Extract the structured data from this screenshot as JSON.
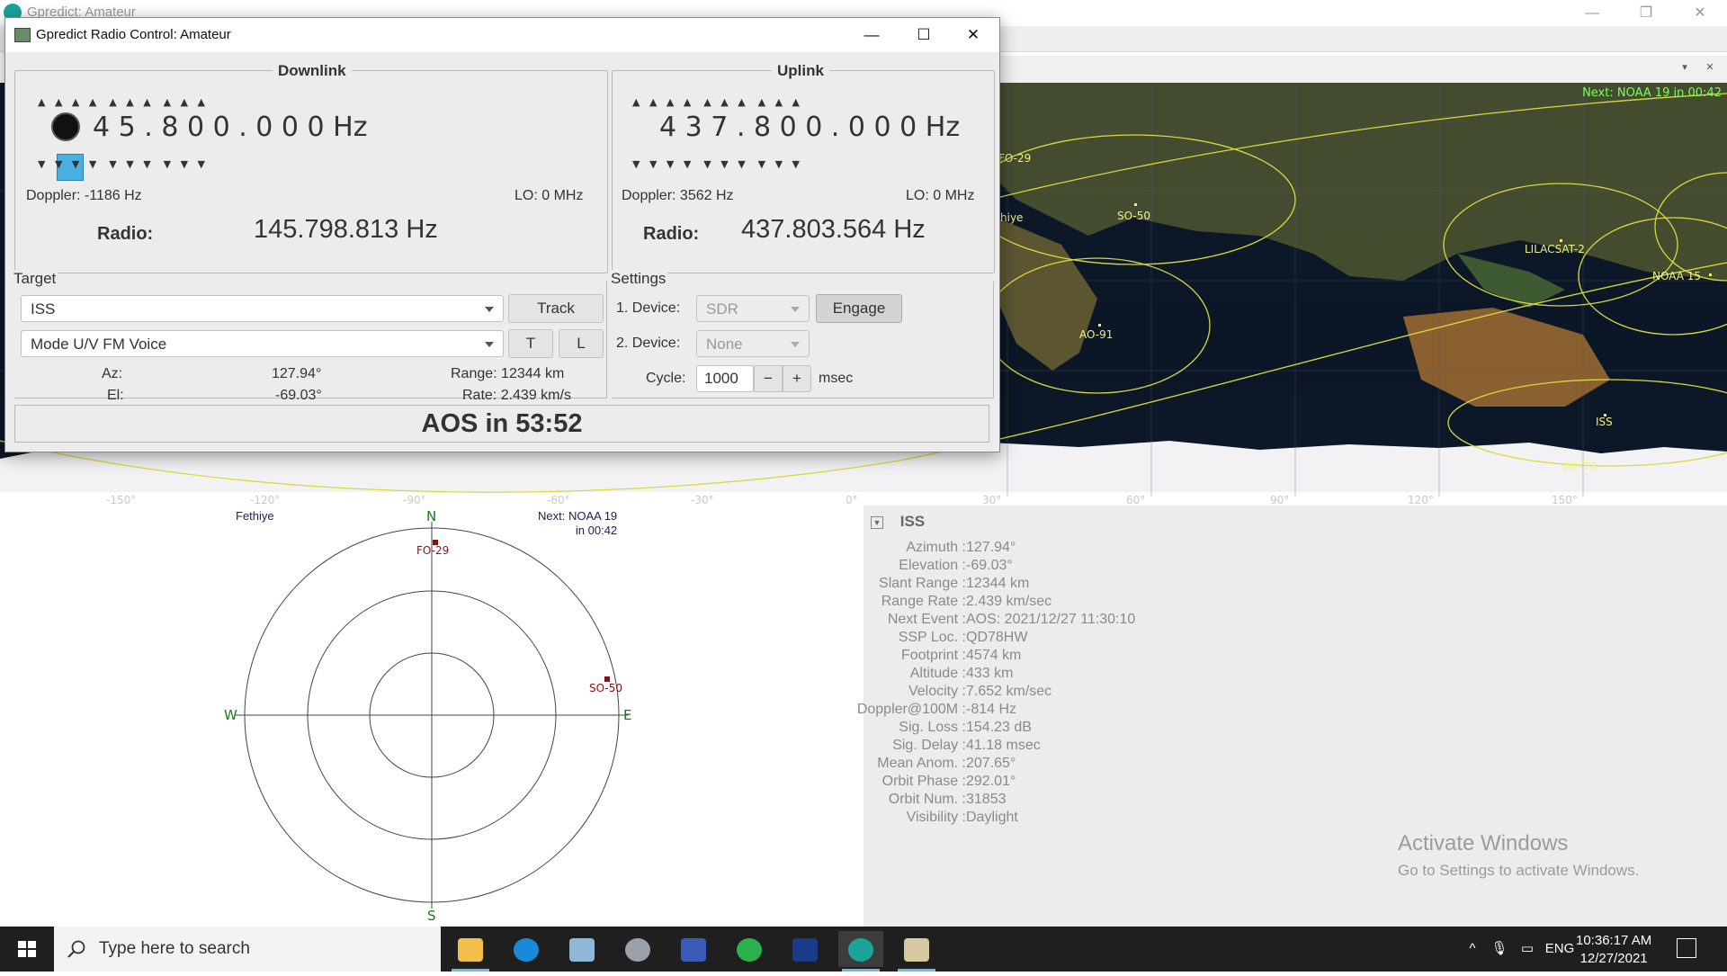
{
  "main_window": {
    "title": "Gpredict: Amateur",
    "controls": {
      "minimize": "—",
      "restore": "❐",
      "close": "✕"
    },
    "map_next_event": "Next: NOAA 19 in 00:42"
  },
  "map": {
    "lon_ticks": [
      "-150°",
      "-120°",
      "-90°",
      "-60°",
      "-30°",
      "0°",
      "30°",
      "60°",
      "90°",
      "120°",
      "150°"
    ],
    "satellites": [
      "FO-29",
      "SO-50",
      "LILACSAT-2",
      "NOAA 15",
      "AO-91",
      "ISS",
      "AO-73"
    ],
    "qth_fragment": "hiye"
  },
  "polar": {
    "qth": "Fethiye",
    "next_line1": "Next: NOAA 19",
    "next_line2": "in 00:42",
    "compass": {
      "n": "N",
      "s": "S",
      "e": "E",
      "w": "W"
    },
    "satellites": [
      "FO-29",
      "SO-50"
    ]
  },
  "details": {
    "sat_name": "ISS",
    "rows": [
      {
        "label": "Azimuth :",
        "value": "127.94°"
      },
      {
        "label": "Elevation :",
        "value": "-69.03°"
      },
      {
        "label": "Slant Range :",
        "value": "12344 km"
      },
      {
        "label": "Range Rate :",
        "value": "2.439 km/sec"
      },
      {
        "label": "Next Event :",
        "value": "AOS: 2021/12/27 11:30:10"
      },
      {
        "label": "SSP Loc. :",
        "value": "QD78HW"
      },
      {
        "label": "Footprint :",
        "value": "4574 km"
      },
      {
        "label": "Altitude :",
        "value": "433 km"
      },
      {
        "label": "Velocity :",
        "value": "7.652 km/sec"
      },
      {
        "label": "Doppler@100M :",
        "value": "-814 Hz"
      },
      {
        "label": "Sig. Loss :",
        "value": "154.23 dB"
      },
      {
        "label": "Sig. Delay :",
        "value": "41.18 msec"
      },
      {
        "label": "Mean Anom. :",
        "value": "207.65°"
      },
      {
        "label": "Orbit Phase :",
        "value": "292.01°"
      },
      {
        "label": "Orbit Num. :",
        "value": "31853"
      },
      {
        "label": "Visibility :",
        "value": "Daylight"
      }
    ],
    "activate_title": "Activate Windows",
    "activate_sub": "Go to Settings to activate Windows."
  },
  "dialog": {
    "title": "Gpredict Radio Control: Amateur",
    "downlink": {
      "label": "Downlink",
      "freq_digits": "4 5 . 8 0 0 . 0 0 0",
      "unit": "Hz",
      "up_arrows": "▲   ▲   ▲   ▲    ▲   ▲   ▲    ▲   ▲   ▲",
      "down_arrows": "▼   ▼   ▼   ▼    ▼   ▼   ▼    ▼   ▼   ▼",
      "doppler": "Doppler: -1186 Hz",
      "lo": "LO: 0 MHz",
      "radio_label": "Radio:",
      "radio_value": "145.798.813 Hz"
    },
    "uplink": {
      "label": "Uplink",
      "freq_digits": "4 3 7 . 8 0 0 . 0 0 0",
      "unit": "Hz",
      "up_arrows": "▲   ▲   ▲   ▲    ▲   ▲   ▲    ▲   ▲   ▲",
      "down_arrows": "▼   ▼   ▼   ▼    ▼   ▼   ▼    ▼   ▼   ▼",
      "doppler": "Doppler: 3562 Hz",
      "lo": "LO: 0 MHz",
      "radio_label": "Radio:",
      "radio_value": "437.803.564 Hz"
    },
    "target": {
      "label": "Target",
      "satellite": "ISS",
      "track_button": "Track",
      "mode": "Mode U/V FM Voice",
      "t_button": "T",
      "l_button": "L",
      "az_label": "Az:",
      "az_value": "127.94°",
      "range": "Range: 12344 km",
      "el_label": "El:",
      "el_value": "-69.03°",
      "rate": "Rate: 2.439 km/s"
    },
    "settings": {
      "label": "Settings",
      "device1_label": "1. Device:",
      "device1_value": "SDR",
      "engage_button": "Engage",
      "device2_label": "2. Device:",
      "device2_value": "None",
      "cycle_label": "Cycle:",
      "cycle_value": "1000",
      "minus": "−",
      "plus": "+",
      "cycle_unit": "msec"
    },
    "aos": "AOS in 53:52"
  },
  "taskbar": {
    "search_placeholder": "Type here to search",
    "lang": "ENG",
    "time": "10:36:17 AM",
    "date": "12/27/2021"
  }
}
